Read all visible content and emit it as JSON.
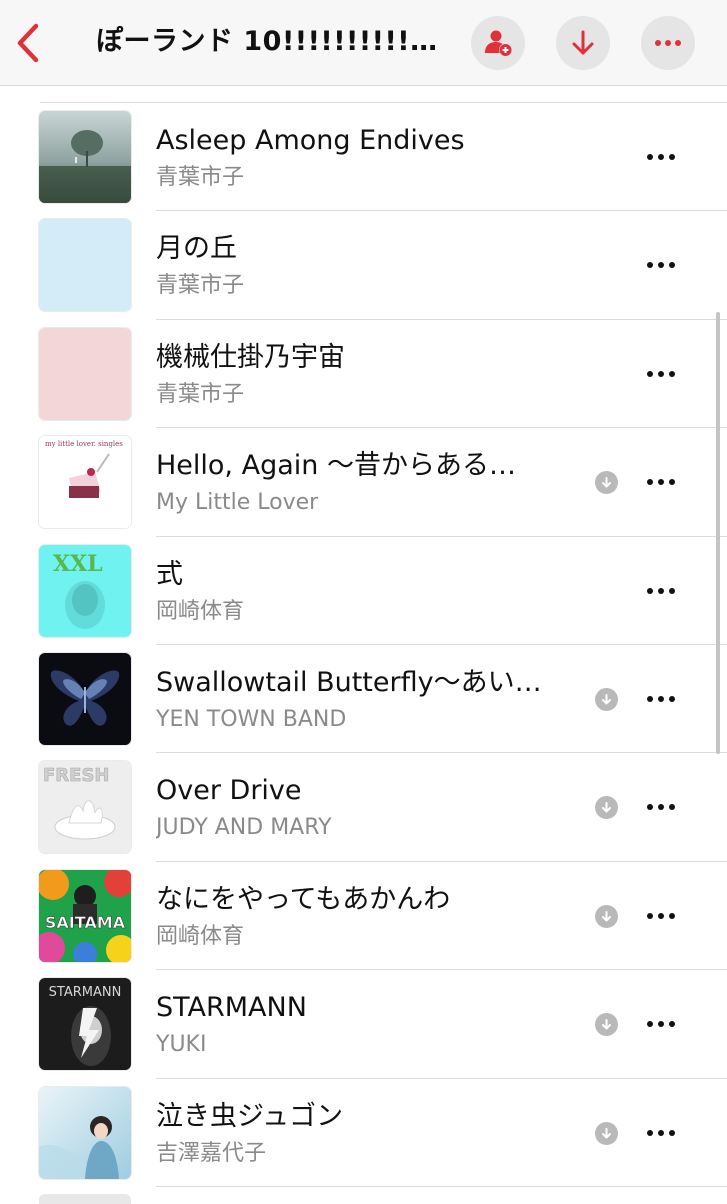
{
  "header": {
    "back_icon": "chevron-left-icon",
    "title": "ぽーランド 10!!!!!!!!!!…",
    "accent_color": "#e0313b",
    "buttons": [
      {
        "icon": "person-add-icon"
      },
      {
        "icon": "download-arrow-icon"
      },
      {
        "icon": "ellipsis-icon"
      }
    ]
  },
  "songs": [
    {
      "title": "Asleep Among Endives",
      "artist": "青葉市子",
      "downloaded": false
    },
    {
      "title": "月の丘",
      "artist": "青葉市子",
      "downloaded": false
    },
    {
      "title": "機械仕掛乃宇宙",
      "artist": "青葉市子",
      "downloaded": false
    },
    {
      "title": "Hello, Again ～昔からある…",
      "artist": "My Little Lover",
      "downloaded": true,
      "art_text": "my little lover. singles"
    },
    {
      "title": "式",
      "artist": "岡崎体育",
      "downloaded": false,
      "art_text": "XXL"
    },
    {
      "title": "Swallowtail Butterfly～あい…",
      "artist": "YEN TOWN BAND",
      "downloaded": true
    },
    {
      "title": "Over Drive",
      "artist": "JUDY AND MARY",
      "downloaded": true,
      "art_text": "FRESH"
    },
    {
      "title": "なにをやってもあかんわ",
      "artist": "岡崎体育",
      "downloaded": true,
      "art_text": "SAITAMA"
    },
    {
      "title": "STARMANN",
      "artist": "YUKI",
      "downloaded": true,
      "art_text": "STARMANN"
    },
    {
      "title": "泣き虫ジュゴン",
      "artist": "吉澤嘉代子",
      "downloaded": true
    }
  ]
}
